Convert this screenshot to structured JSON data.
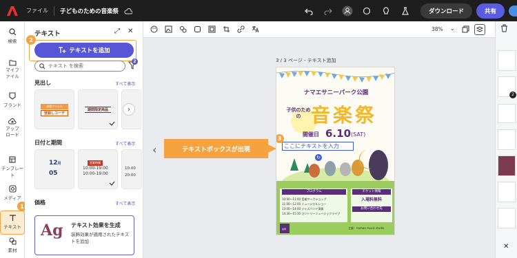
{
  "header": {
    "file_menu": "ファイル",
    "doc_title": "子どものための音楽祭",
    "download_label": "ダウンロード",
    "share_label": "共有"
  },
  "rail": {
    "items": [
      {
        "label": "検索",
        "icon": "search-icon"
      },
      {
        "label": "マイファイル",
        "icon": "folder-icon"
      },
      {
        "label": "ブランド",
        "icon": "brand-icon"
      },
      {
        "label": "アップロード",
        "icon": "upload-icon"
      },
      {
        "label": "テンプレート",
        "icon": "template-icon"
      },
      {
        "label": "メディア",
        "icon": "media-icon"
      },
      {
        "label": "テキスト",
        "icon": "text-icon"
      },
      {
        "label": "素材",
        "icon": "elements-icon"
      }
    ]
  },
  "panel": {
    "title": "テキスト",
    "add_text_label": "テキストを追加",
    "search_placeholder": "テキスト を検索",
    "filter_badge": "2",
    "sections": {
      "headings": {
        "title": "見出し",
        "see_all": "すべて表示"
      },
      "dates": {
        "title": "日付と期間",
        "see_all": "すべて表示"
      },
      "price": {
        "title": "価格",
        "see_all": "すべて表示"
      }
    },
    "heading_cards": [
      "本格アイテム",
      "登録しコーデ",
      "期間限定商品"
    ],
    "date_cards": {
      "card1": {
        "top": "12",
        "unit": "月",
        "bottom": "05"
      },
      "card2": {
        "head": "営業時間",
        "line1": "10:00-19:00",
        "line2": "10:00-19:00"
      },
      "card3": {
        "line1": "10:00",
        "line2": "20:00"
      }
    },
    "effect": {
      "glyph": "Ag",
      "title": "テキスト効果を生成",
      "description": "装飾効果が適用されたテキストを追加"
    }
  },
  "canvas": {
    "zoom": "38%",
    "page_label": "3 / 3 ページ - テキスト追加",
    "callout": "テキストボックスが出現"
  },
  "steps": [
    "1",
    "2",
    "3"
  ],
  "poster": {
    "park": "ナマエサニーパーク公園",
    "subtitle_small": "子供のための",
    "title": "音楽祭",
    "date_prefix": "開催日",
    "date": "6.10",
    "day": "(SAT)",
    "placeholder": "ここにテキストを入力",
    "program_head": "プログラム",
    "ticket_head": "チケット情報",
    "ticket_value": "入場料無料",
    "contact_head": "お問い合わせ先",
    "program": [
      "10:00〜11:00 音楽ワークショップ",
      "11:00〜12:00 ミュージカルショー",
      "13:00〜14:00 ジャズバンド演奏",
      "14:30〜15:30 カントリーミュージックライブ"
    ],
    "organizer": "主催：namae music studio"
  },
  "colors": {
    "accent_orange": "#f4a340",
    "primary_purple": "#5656d6",
    "poster_title": "#f2b829",
    "poster_purple": "#5a2e7a",
    "poster_green": "#9acd5c"
  }
}
